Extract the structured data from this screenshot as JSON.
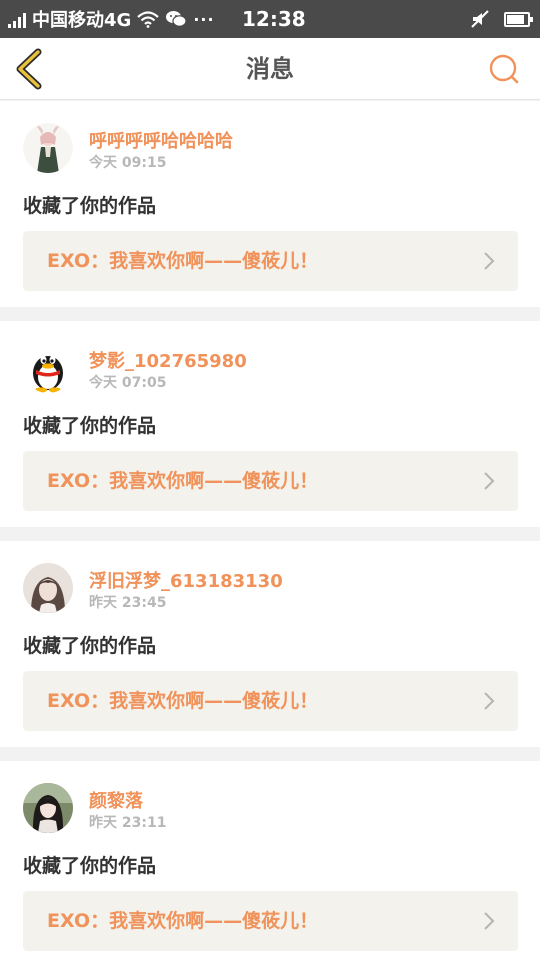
{
  "status_bar": {
    "carrier": "中国移动4G",
    "time": "12:38"
  },
  "nav": {
    "title": "消息"
  },
  "messages": [
    {
      "username": "呼呼呼呼哈哈哈哈",
      "time": "今天 09:15",
      "action": "收藏了你的作品",
      "work_title": "EXO：我喜欢你啊——傻莜儿！"
    },
    {
      "username": "梦影_102765980",
      "time": "今天 07:05",
      "action": "收藏了你的作品",
      "work_title": "EXO：我喜欢你啊——傻莜儿！"
    },
    {
      "username": "浮旧浮梦_613183130",
      "time": "昨天 23:45",
      "action": "收藏了你的作品",
      "work_title": "EXO：我喜欢你啊——傻莜儿！"
    },
    {
      "username": "颜黎落",
      "time": "昨天 23:11",
      "action": "收藏了你的作品",
      "work_title": "EXO：我喜欢你啊——傻莜儿！"
    }
  ],
  "colors": {
    "accent": "#f0925a",
    "back_arrow": "#e8c23a",
    "status_bar_bg": "#4a4a4a"
  }
}
